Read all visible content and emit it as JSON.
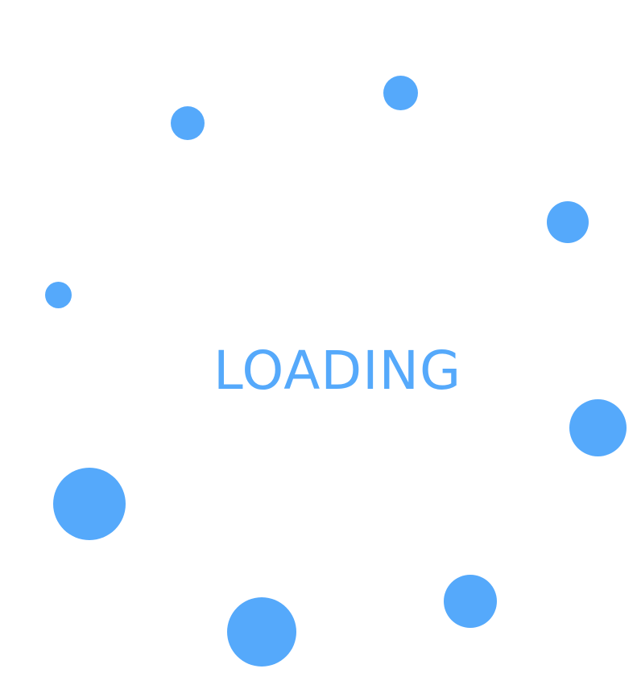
{
  "loader": {
    "label": "LOADING",
    "accent_color": "#55a9fb",
    "background_color": "#ffffff",
    "dot_count": 8
  }
}
